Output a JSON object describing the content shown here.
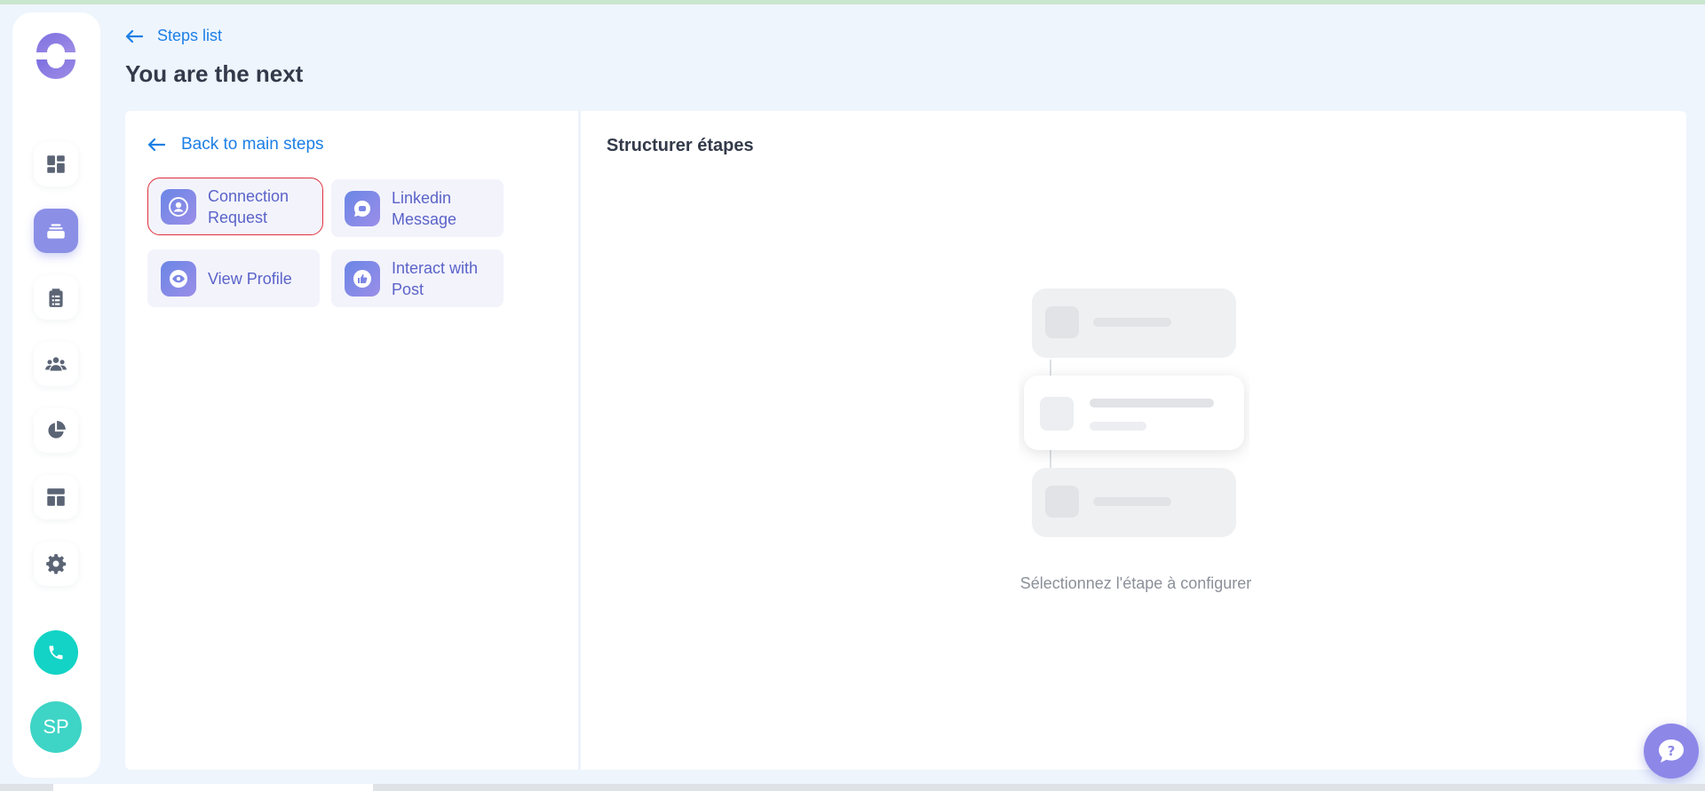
{
  "header": {
    "back_label": "Steps list",
    "title": "You are the next"
  },
  "sidebar": {
    "items": [
      {
        "name": "dashboard",
        "icon": "dashboard-icon",
        "active": false
      },
      {
        "name": "campaigns",
        "icon": "inbox-stack-icon",
        "active": true
      },
      {
        "name": "tasks",
        "icon": "clipboard-icon",
        "active": false
      },
      {
        "name": "contacts",
        "icon": "users-icon",
        "active": false
      },
      {
        "name": "reports",
        "icon": "pie-chart-icon",
        "active": false
      },
      {
        "name": "templates",
        "icon": "layout-icon",
        "active": false
      },
      {
        "name": "settings",
        "icon": "gear-icon",
        "active": false
      }
    ],
    "call_icon": "phone-icon",
    "avatar_initials": "SP"
  },
  "left_pane": {
    "back_label": "Back to main steps",
    "steps": [
      {
        "label": "Connection Request",
        "icon": "user-icon",
        "selected": true
      },
      {
        "label": "Linkedin Message",
        "icon": "message-icon",
        "selected": false
      },
      {
        "label": "View Profile",
        "icon": "eye-icon",
        "selected": false
      },
      {
        "label": "Interact with Post",
        "icon": "thumbs-up-icon",
        "selected": false
      }
    ]
  },
  "right_pane": {
    "title": "Structurer étapes",
    "empty_message": "Sélectionnez l'étape à configurer"
  },
  "colors": {
    "accent": "#1d7fe6",
    "sidebar_active": "#8b8fe6",
    "selected_border": "#e0303c",
    "call_button": "#12d3c5",
    "help_button": "#8d87e8"
  }
}
